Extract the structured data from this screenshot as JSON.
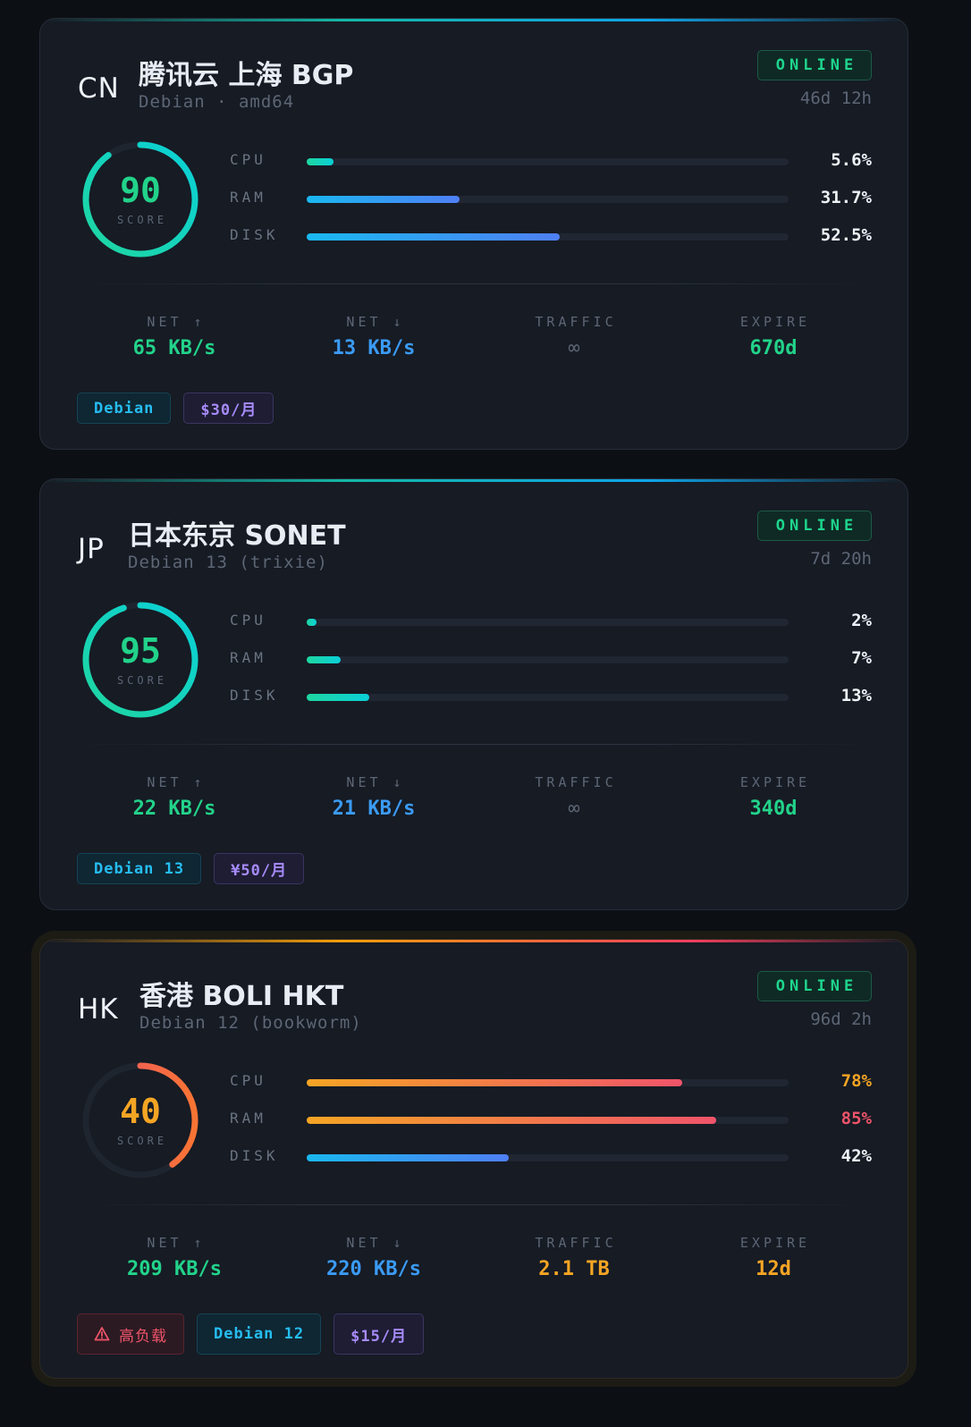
{
  "score_label": "SCORE",
  "metric_labels": {
    "cpu": "CPU",
    "ram": "RAM",
    "disk": "DISK"
  },
  "stat_labels": {
    "up": "NET ↑",
    "down": "NET ↓",
    "traffic": "TRAFFIC",
    "expire": "EXPIRE"
  },
  "colors": {
    "green": "#22d38a",
    "blue": "#3b9bf5",
    "orange": "#f5a524",
    "red": "#f0546a",
    "white": "#eef2f7",
    "muted": "#5d6675",
    "teal": "#14d4c4"
  },
  "servers": [
    {
      "flag": "CN",
      "name": "腾讯云 上海 BGP",
      "os": "Debian · amd64",
      "status": "ONLINE",
      "uptime": "46d 12h",
      "score": "90",
      "score_fraction": 0.9,
      "cpu": "5.6%",
      "cpu_fraction": 0.056,
      "ram": "31.7%",
      "ram_fraction": 0.317,
      "disk": "52.5%",
      "disk_fraction": 0.525,
      "net_up": "65 KB/s",
      "net_down": "13 KB/s",
      "traffic": "∞",
      "expire": "670d",
      "os_tag": "Debian",
      "price_tag": "$30/月"
    },
    {
      "flag": "JP",
      "name": "日本东京 SONET",
      "os": "Debian 13 (trixie)",
      "status": "ONLINE",
      "uptime": "7d 20h",
      "score": "95",
      "score_fraction": 0.95,
      "cpu": "2%",
      "cpu_fraction": 0.02,
      "ram": "7%",
      "ram_fraction": 0.07,
      "disk": "13%",
      "disk_fraction": 0.13,
      "net_up": "22 KB/s",
      "net_down": "21 KB/s",
      "traffic": "∞",
      "expire": "340d",
      "os_tag": "Debian 13",
      "price_tag": "¥50/月"
    },
    {
      "flag": "HK",
      "name": "香港 BOLI HKT",
      "os": "Debian 12 (bookworm)",
      "status": "ONLINE",
      "uptime": "96d 2h",
      "score": "40",
      "score_fraction": 0.4,
      "cpu": "78%",
      "cpu_fraction": 0.78,
      "ram": "85%",
      "ram_fraction": 0.85,
      "disk": "42%",
      "disk_fraction": 0.42,
      "net_up": "209 KB/s",
      "net_down": "220 KB/s",
      "traffic": "2.1 TB",
      "expire": "12d",
      "alert_icon": "warning-triangle-icon",
      "alert_tag": "高负载",
      "os_tag": "Debian 12",
      "price_tag": "$15/月"
    }
  ]
}
